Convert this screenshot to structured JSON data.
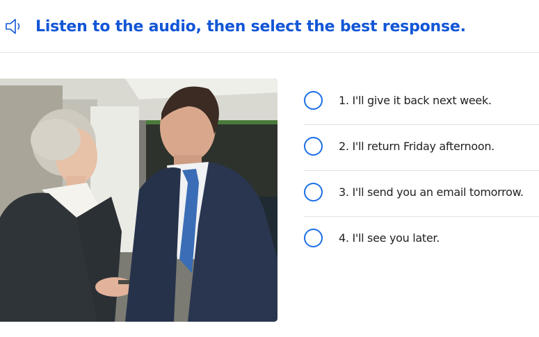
{
  "prompt": {
    "title": "Listen to the audio, then select the best response.",
    "audio_icon": "speaker-icon"
  },
  "image": {
    "icon": "photo-two-business-people-talking"
  },
  "options": [
    {
      "label": "1. I'll give it back next week."
    },
    {
      "label": "2. I'll return Friday afternoon."
    },
    {
      "label": "3. I'll send you an email tomorrow."
    },
    {
      "label": "4. I'll see you later."
    }
  ],
  "colors": {
    "accent": "#1256d6",
    "radio": "#1a6ee6",
    "divider": "#dfe3e8",
    "text": "#222222"
  }
}
